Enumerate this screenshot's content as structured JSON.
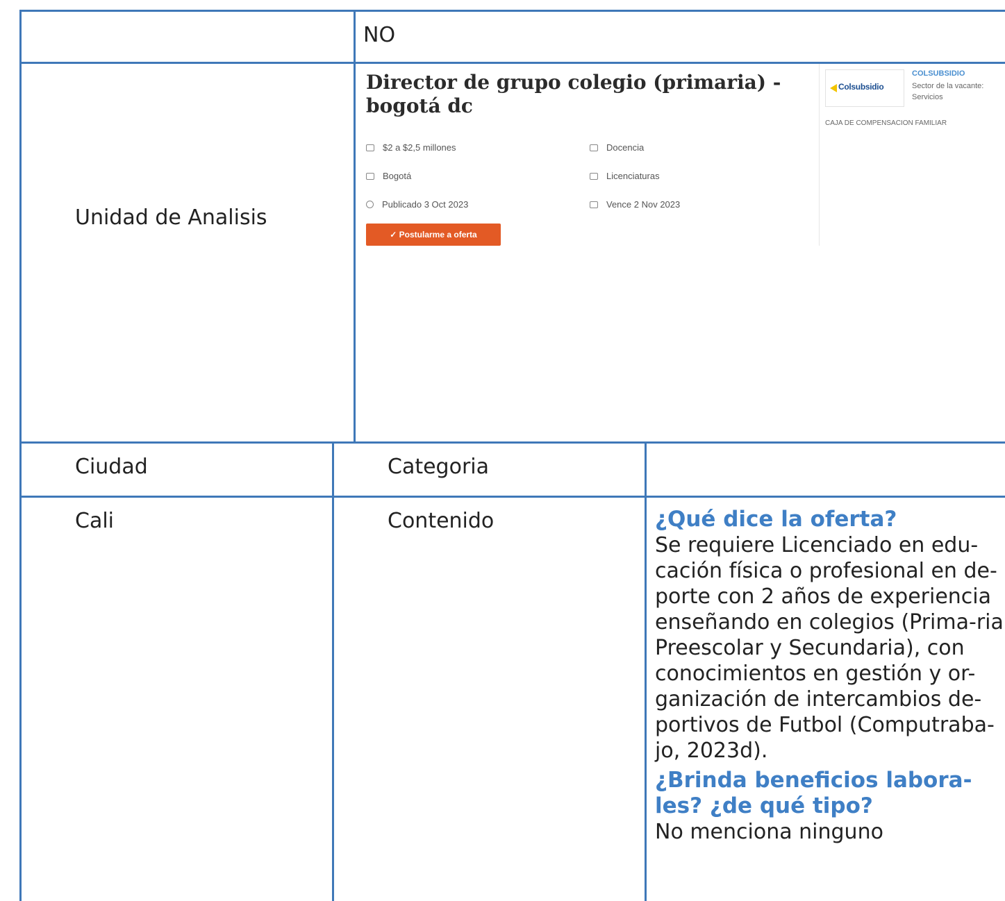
{
  "table": {
    "row1": {
      "value": "NO"
    },
    "row2": {
      "label": "Unidad de Analisis"
    },
    "header": {
      "col1": "Ciudad",
      "col2": "Categoria",
      "col3": ""
    },
    "row4": {
      "ciudad": "Cali",
      "categoria": "Contenido",
      "q1_heading": "¿Qué dice la oferta?",
      "q1_text": "Se requiere Licenciado en edu-cación física o profesional en de-porte con 2 años de experiencia enseñando en colegios (Prima-ria, Preescolar y Secundaria), con conocimientos en gestión y or-ganización de intercambios de-portivos de Futbol (Computraba-jo, 2023d).",
      "q2_heading": "¿Brinda beneficios labora-les? ¿de qué tipo?",
      "q2_text": "No menciona ninguno"
    }
  },
  "offer": {
    "title": "Director de grupo colegio (primaria) - bogotá dc",
    "salary": "$2 a $2,5 millones",
    "area": "Docencia",
    "city": "Bogotá",
    "education": "Licenciaturas",
    "published": "Publicado 3 Oct 2023",
    "expires": "Vence 2 Nov 2023",
    "apply_label": "✓ Postularme a oferta",
    "company": {
      "logo_text": "Colsubsidio",
      "name": "COLSUBSIDIO",
      "sector_label": "Sector de la vacante:",
      "sector_value": "Servicios",
      "type": "CAJA DE COMPENSACION FAMILIAR"
    }
  },
  "colors": {
    "border": "#3f78b8",
    "heading": "#3f7fc5",
    "button": "#e35a25"
  }
}
